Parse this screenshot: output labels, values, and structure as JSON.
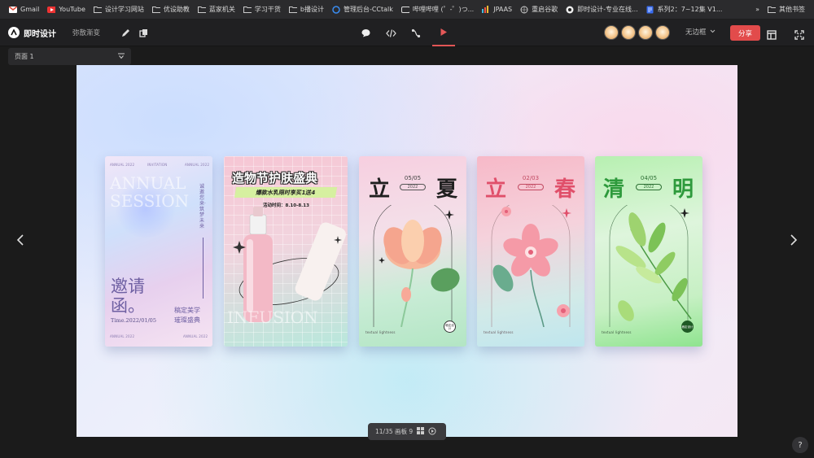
{
  "bookmarks": [
    {
      "label": "Gmail",
      "icon": "gmail-icon"
    },
    {
      "label": "YouTube",
      "icon": "youtube-icon"
    },
    {
      "label": "设计学习网站",
      "icon": "folder-icon"
    },
    {
      "label": "优设助教",
      "icon": "folder-icon"
    },
    {
      "label": "蓝家机关",
      "icon": "folder-icon"
    },
    {
      "label": "学习干货",
      "icon": "folder-icon"
    },
    {
      "label": "b播设计",
      "icon": "folder-icon"
    },
    {
      "label": "管理后台-CCtalk",
      "icon": "cctalk-icon"
    },
    {
      "label": "哔哩哔哩 (゜-゜)つ...",
      "icon": "bilibili-icon"
    },
    {
      "label": "JPAAS",
      "icon": "jpaas-icon"
    },
    {
      "label": "重启谷歌",
      "icon": "globe-icon"
    },
    {
      "label": "即时设计-专业在线...",
      "icon": "jsdesign-icon"
    },
    {
      "label": "系列2：7~12集 V1...",
      "icon": "doc-icon"
    }
  ],
  "bookmarks_more": "»",
  "bookmarks_other": "其他书签",
  "app": {
    "name": "即时设计",
    "project": "弥散渐变",
    "border_option": "无边框",
    "share_label": "分享"
  },
  "page_selector": {
    "value": "页面 1"
  },
  "cards": [
    {
      "big_text": "ANNUAL SESSION",
      "small_top_left": "ANNUAL 2022",
      "small_top_mid": "INVITATION",
      "small_top_right": "ANNUAL 2022",
      "vertical_text": "诚邀您来·筑梦未来",
      "title_line1": "邀请",
      "title_line2": "函。",
      "time": "Time.2022/01/05",
      "subtitle1": "稿定美学",
      "subtitle2": "璀璨盛典",
      "footer_left": "ANNUAL 2022",
      "footer_right": "ANNUAL 2022"
    },
    {
      "title": "造物节护肤盛典",
      "banner": "爆款水乳限时享买1送4",
      "activity": "活动时间：8.10-8.13",
      "bg_text": "INFUSION"
    },
    {
      "char_left": "立",
      "char_right": "夏",
      "date": "05/05",
      "year": "2022",
      "stamp": "稿定设计",
      "footer": "textual lightness"
    },
    {
      "char_left": "立",
      "char_right": "春",
      "date": "02/03",
      "year": "2022",
      "stamp": "稿定设计",
      "footer": "textual lightness"
    },
    {
      "char_left": "清",
      "char_right": "明",
      "date": "04/05",
      "year": "2022",
      "stamp": "稿定设计",
      "footer": "textual lightness"
    }
  ],
  "bottom_bar": {
    "counter": "11/35 画板 9"
  },
  "help_label": "?"
}
